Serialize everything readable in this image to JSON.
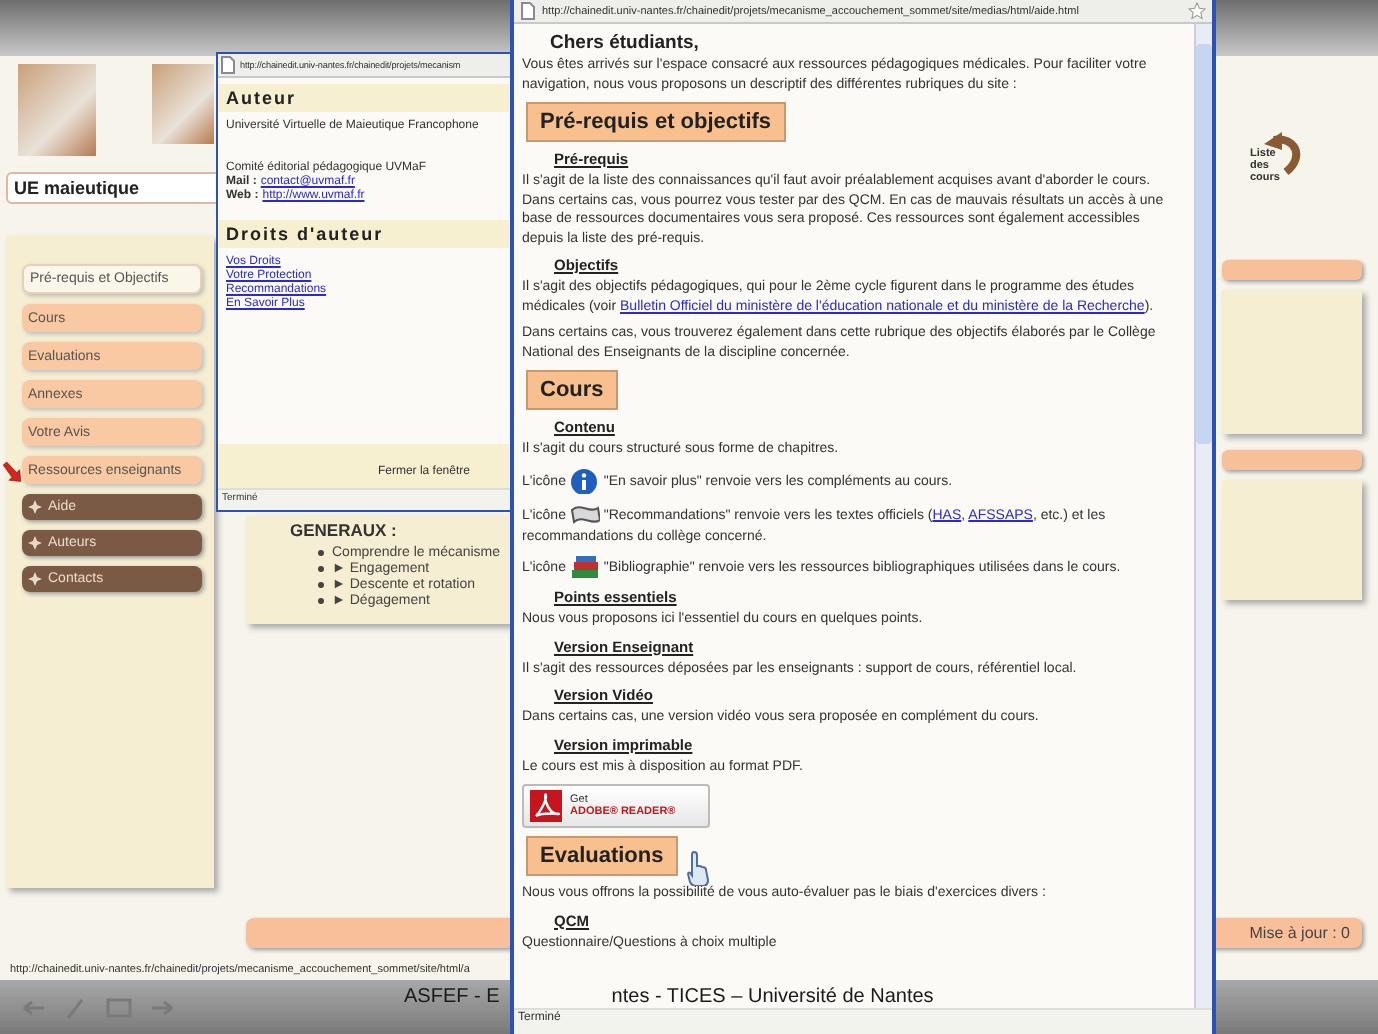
{
  "site": {
    "course_title": "UE maieutique",
    "courses_link": "Liste des cours",
    "menu": [
      {
        "label": "Pré-requis et Objectifs",
        "kind": "section",
        "selected": true
      },
      {
        "label": "Cours",
        "kind": "section",
        "selected": false
      },
      {
        "label": "Evaluations",
        "kind": "section",
        "selected": false
      },
      {
        "label": "Annexes",
        "kind": "section",
        "selected": false
      },
      {
        "label": "Votre Avis",
        "kind": "section",
        "selected": false
      },
      {
        "label": "Ressources enseignants",
        "kind": "section",
        "selected": false
      },
      {
        "label": "Aide",
        "kind": "action",
        "selected": false
      },
      {
        "label": "Auteurs",
        "kind": "action",
        "selected": false
      },
      {
        "label": "Contacts",
        "kind": "action",
        "selected": false
      }
    ],
    "objectives": {
      "title": "GENERAUX :",
      "items": [
        "Comprendre le mécanisme",
        "► Engagement",
        "► Descente et rotation",
        "► Dégagement"
      ]
    },
    "update": "Mise à jour : 0",
    "status_url": "http://chainedit.univ-nantes.fr/chainedit/projets/mecanisme_accouchement_sommet/site/html/a"
  },
  "author_window": {
    "url": "http://chainedit.univ-nantes.fr/chainedit/projets/mecanism",
    "sections": [
      {
        "title": "Auteur",
        "text": "Université Virtuelle de Maieutique Francophone",
        "contact": [
          {
            "text": "Comité éditorial pédagogique UVMaF"
          },
          {
            "label": "Mail :",
            "link": "contact@uvmaf.fr"
          },
          {
            "label": "Web :",
            "link": "http://www.uvmaf.fr"
          }
        ]
      },
      {
        "title": "Droits d'auteur",
        "links": [
          "Vos Droits",
          "Votre Protection",
          "Recommandations",
          "En Savoir Plus"
        ]
      }
    ],
    "close": "Fermer la fenêtre",
    "status": "Terminé"
  },
  "help_window": {
    "url": "http://chainedit.univ-nantes.fr/chainedit/projets/mecanisme_accouchement_sommet/site/medias/html/aide.html",
    "greeting": "Chers étudiants,",
    "intro": "Vous êtes arrivés sur l'espace consacré aux ressources pédagogiques médicales. Pour faciliter votre navigation, nous vous proposons un descriptif des différentes rubriques du site :",
    "sections": [
      {
        "title": "Pré-requis et objectifs",
        "blocks": [
          {
            "kind": "subheading",
            "text": "Pré-requis"
          },
          {
            "kind": "paragraph",
            "parts": [
              {
                "text": "Il s'agit de la liste des connaissances qu'il faut avoir préalablement acquises avant d'aborder le cours. Dans certains cas, vous pourrez vous tester par des QCM. En cas de mauvais résultats un accès à une base de ressources documentaires vous sera proposé. Ces ressources sont également accessibles depuis la liste des pré-requis."
              }
            ]
          },
          {
            "kind": "subheading",
            "text": "Objectifs"
          },
          {
            "kind": "paragraph",
            "parts": [
              {
                "text": "Il s'agit des objectifs pédagogiques, qui pour le 2ème cycle figurent dans le programme des études médicales (voir "
              },
              {
                "kind": "link",
                "text": "Bulletin Officiel du ministère de l'éducation nationale et du ministère de la Recherche"
              },
              {
                "text": ")."
              }
            ]
          },
          {
            "kind": "paragraph",
            "parts": [
              {
                "text": "Dans certains cas, vous trouverez également dans cette rubrique des objectifs élaborés par le Collège National des Enseignants de la discipline concernée."
              }
            ]
          }
        ]
      },
      {
        "title": "Cours",
        "blocks": [
          {
            "kind": "subheading",
            "text": "Contenu"
          },
          {
            "kind": "paragraph",
            "parts": [
              {
                "text": "Il s'agit du cours structuré sous forme de chapitres."
              }
            ]
          },
          {
            "kind": "paragraph",
            "parts": [
              {
                "text": "L'icône "
              },
              {
                "kind": "icon"
              },
              {
                "text": " \"En savoir plus\" renvoie vers les compléments au cours."
              }
            ]
          },
          {
            "kind": "paragraph",
            "parts": [
              {
                "text": "L'icône "
              },
              {
                "kind": "icon"
              },
              {
                "text": " \"Recommandations\" renvoie vers les textes officiels ("
              },
              {
                "kind": "link",
                "text": "HAS"
              },
              {
                "text": ", "
              },
              {
                "kind": "link",
                "text": "AFSSAPS"
              },
              {
                "text": ", etc.) et les recommandations du collège concerné."
              }
            ]
          },
          {
            "kind": "paragraph",
            "parts": [
              {
                "text": "L'icône "
              },
              {
                "kind": "icon"
              },
              {
                "text": " \"Bibliographie\" renvoie vers les ressources bibliographiques utilisées dans le cours."
              }
            ]
          },
          {
            "kind": "subheading",
            "text": "Points essentiels"
          },
          {
            "kind": "paragraph",
            "parts": [
              {
                "text": "Nous vous proposons ici l'essentiel du cours en quelques points."
              }
            ]
          },
          {
            "kind": "subheading",
            "text": "Version Enseignant"
          },
          {
            "kind": "paragraph",
            "parts": [
              {
                "text": "Il s'agit des ressources déposées par les enseignants : support de cours, référentiel local."
              }
            ]
          },
          {
            "kind": "subheading",
            "text": "Version Vidéo"
          },
          {
            "kind": "paragraph",
            "parts": [
              {
                "text": "Dans certains cas, une version vidéo vous sera proposée en complément du cours."
              }
            ]
          },
          {
            "kind": "subheading",
            "text": "Version imprimable"
          },
          {
            "kind": "paragraph",
            "parts": [
              {
                "text": "Le cours est mis à disposition au format PDF."
              }
            ]
          },
          {
            "kind": "reader_badge",
            "lines": [
              "Get",
              "ADOBE® READER®"
            ]
          }
        ]
      },
      {
        "title": "Evaluations",
        "blocks": [
          {
            "kind": "paragraph",
            "parts": [
              {
                "text": "Nous vous offrons la possibilité de vous auto-évaluer pas le biais d'exercices divers :"
              }
            ]
          },
          {
            "kind": "subheading",
            "text": "QCM"
          },
          {
            "kind": "paragraph",
            "parts": [
              {
                "text": "Questionnaire/Questions à choix multiple"
              }
            ]
          }
        ]
      }
    ],
    "status": "Terminé"
  },
  "footer": {
    "parts": [
      "ASFEF - E",
      "ntes - TICES – Université de Nantes"
    ]
  }
}
